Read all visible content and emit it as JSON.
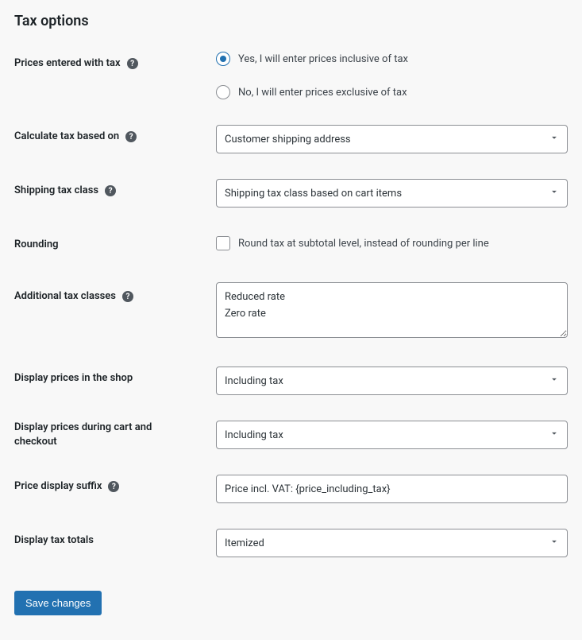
{
  "section_title": "Tax options",
  "fields": {
    "prices_with_tax": {
      "label": "Prices entered with tax",
      "option_yes": "Yes, I will enter prices inclusive of tax",
      "option_no": "No, I will enter prices exclusive of tax"
    },
    "calculate_tax": {
      "label": "Calculate tax based on",
      "value": "Customer shipping address"
    },
    "shipping_tax_class": {
      "label": "Shipping tax class",
      "value": "Shipping tax class based on cart items"
    },
    "rounding": {
      "label": "Rounding",
      "checkbox_label": "Round tax at subtotal level, instead of rounding per line"
    },
    "additional_tax_classes": {
      "label": "Additional tax classes",
      "value": "Reduced rate\nZero rate"
    },
    "display_shop": {
      "label": "Display prices in the shop",
      "value": "Including tax"
    },
    "display_cart": {
      "label": "Display prices during cart and checkout",
      "value": "Including tax"
    },
    "price_suffix": {
      "label": "Price display suffix",
      "value": "Price incl. VAT: {price_including_tax}"
    },
    "display_tax_totals": {
      "label": "Display tax totals",
      "value": "Itemized"
    }
  },
  "save_button_label": "Save changes"
}
